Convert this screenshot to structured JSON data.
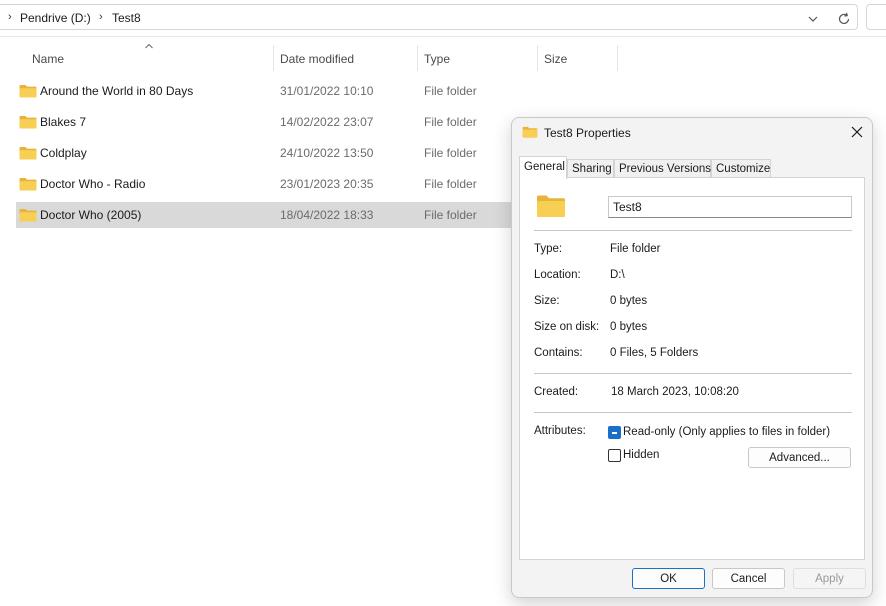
{
  "explorer": {
    "breadcrumb": [
      "Pendrive (D:)",
      "Test8"
    ],
    "columns": {
      "name": "Name",
      "date_modified": "Date modified",
      "type": "Type",
      "size": "Size"
    },
    "rows": [
      {
        "name": "Around the World in 80 Days",
        "date": "31/01/2022 10:10",
        "type": "File folder"
      },
      {
        "name": "Blakes 7",
        "date": "14/02/2022 23:07",
        "type": "File folder"
      },
      {
        "name": "Coldplay",
        "date": "24/10/2022 13:50",
        "type": "File folder"
      },
      {
        "name": "Doctor Who - Radio",
        "date": "23/01/2023 20:35",
        "type": "File folder"
      },
      {
        "name": "Doctor Who (2005)",
        "date": "18/04/2022 18:33",
        "type": "File folder",
        "selected": true
      }
    ]
  },
  "dialog": {
    "title": "Test8 Properties",
    "tabs": [
      "General",
      "Sharing",
      "Previous Versions",
      "Customize"
    ],
    "active_tab": "General",
    "folder_name": "Test8",
    "type_label": "Type:",
    "type_value": "File folder",
    "location_label": "Location:",
    "location_value": "D:\\",
    "size_label": "Size:",
    "size_value": "0 bytes",
    "size_on_disk_label": "Size on disk:",
    "size_on_disk_value": "0 bytes",
    "contains_label": "Contains:",
    "contains_value": "0 Files, 5 Folders",
    "created_label": "Created:",
    "created_value": "18 March 2023, 10:08:20",
    "attributes_label": "Attributes:",
    "readonly_label": "Read-only (Only applies to files in folder)",
    "readonly_state": "indeterminate",
    "hidden_label": "Hidden",
    "hidden_state": "unchecked",
    "advanced_label": "Advanced...",
    "ok_label": "OK",
    "cancel_label": "Cancel",
    "apply_label": "Apply"
  },
  "icons": {
    "folder": "folder-icon",
    "close": "close-icon",
    "refresh": "refresh-icon",
    "chevron_down": "chevron-down-icon",
    "chevron_right": "chevron-right-icon",
    "sort_up": "sort-up-icon"
  },
  "colors": {
    "folder_yellow": "#f5c842",
    "accent": "#1a6fc9",
    "selected_row": "#d9d9d9"
  }
}
